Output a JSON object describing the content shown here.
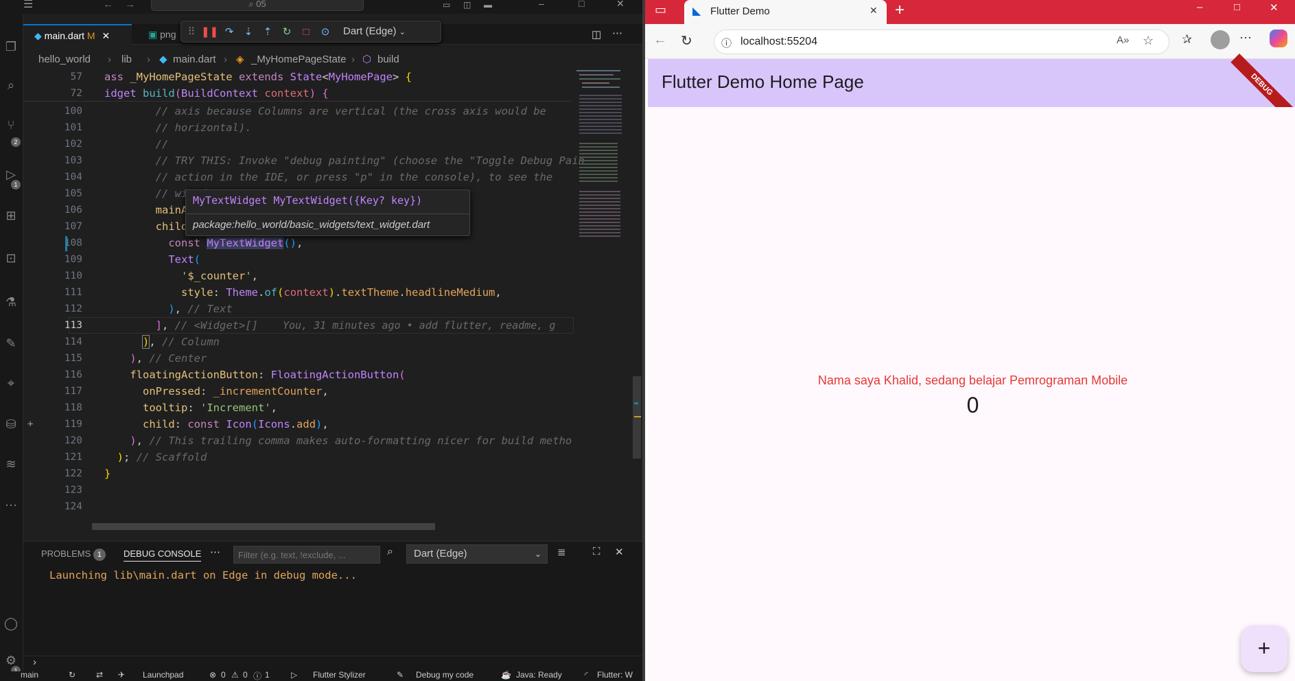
{
  "vscode": {
    "titlebar": {
      "search": "05"
    },
    "tabs": [
      {
        "label": "main.dart",
        "flag": "M"
      },
      {
        "label": "png"
      }
    ],
    "debug": {
      "config": "Dart (Edge)"
    },
    "breadcrumb": [
      "hello_world",
      "lib",
      "main.dart",
      "_MyHomePageState",
      "build"
    ],
    "activity_badges": [
      "2",
      "1",
      "1"
    ],
    "sticky": [
      {
        "num": "57",
        "text": "ass _MyHomePageState extends State<MyHomePage> {"
      },
      {
        "num": "72",
        "text": "idget build(BuildContext context) {"
      }
    ],
    "code_lines": [
      {
        "num": "100",
        "text": "        // axis because Columns are vertical (the cross axis would be"
      },
      {
        "num": "101",
        "text": "        // horizontal)."
      },
      {
        "num": "102",
        "text": "        //"
      },
      {
        "num": "103",
        "text": "        // TRY THIS: Invoke \"debug painting\" (choose the \"Toggle Debug Pain"
      },
      {
        "num": "104",
        "text": "        // action in the IDE, or press \"p\" in the console), to see the"
      },
      {
        "num": "105",
        "text": "        // wiref"
      },
      {
        "num": "106",
        "text": "        mainAxis"
      },
      {
        "num": "107",
        "text": "        children"
      },
      {
        "num": "108",
        "text": "          const MyTextWidget(),"
      },
      {
        "num": "109",
        "text": "          Text("
      },
      {
        "num": "110",
        "text": "            '$_counter',"
      },
      {
        "num": "111",
        "text": "            style: Theme.of(context).textTheme.headlineMedium,"
      },
      {
        "num": "112",
        "text": "          ), // Text"
      },
      {
        "num": "113",
        "text": "        ], // <Widget>[]"
      },
      {
        "num": "114",
        "text": "      ), // Column"
      },
      {
        "num": "115",
        "text": "    ), // Center"
      },
      {
        "num": "116",
        "text": "    floatingActionButton: FloatingActionButton("
      },
      {
        "num": "117",
        "text": "      onPressed: _incrementCounter,"
      },
      {
        "num": "118",
        "text": "      tooltip: 'Increment',"
      },
      {
        "num": "119",
        "text": "      child: const Icon(Icons.add),"
      },
      {
        "num": "120",
        "text": "    ), // This trailing comma makes auto-formatting nicer for build methods"
      },
      {
        "num": "121",
        "text": "  ); // Scaffold"
      },
      {
        "num": "122",
        "text": "}"
      },
      {
        "num": "123",
        "text": ""
      },
      {
        "num": "124",
        "text": ""
      }
    ],
    "blame": "You, 31 minutes ago • add flutter, readme, g",
    "hover": {
      "signature": "MyTextWidget MyTextWidget({Key? key})",
      "package": "package:hello_world/basic_widgets/text_widget.dart"
    },
    "panel": {
      "problems_label": "PROBLEMS",
      "problems_count": "1",
      "debug_console_label": "DEBUG CONSOLE",
      "filter_placeholder": "Filter (e.g. text, !exclude, ...",
      "config": "Dart (Edge)",
      "output": "Launching lib\\main.dart on Edge in debug mode..."
    },
    "status": [
      "main",
      "Launchpad",
      "0",
      "0",
      "1",
      "Flutter Stylizer",
      "Debug my code",
      "Java: Ready",
      "Flutter: W"
    ]
  },
  "browser": {
    "tab_title": "Flutter Demo",
    "url": "localhost:55204",
    "app_title": "Flutter Demo Home Page",
    "debug_banner": "DEBUG",
    "message": "Nama saya Khalid, sedang belajar Pemrograman Mobile",
    "counter": "0",
    "fab_symbol": "+",
    "colors": {
      "titlebar": "#d7273a",
      "appbar": "#d8c6fb",
      "message": "#e53935",
      "body": "#fff9fe"
    }
  }
}
